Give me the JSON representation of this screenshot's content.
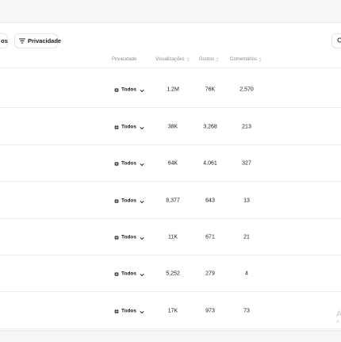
{
  "filters": {
    "left_chip_label": "os",
    "privacy_label": "Privacidade"
  },
  "table": {
    "headers": {
      "privacy": "Privacidade",
      "views": "Visualizações",
      "likes": "Gostos",
      "comments": "Comentários"
    },
    "rows": [
      {
        "privacy": "Todos",
        "views": "1.2M",
        "likes": "76K",
        "comments": "2,570"
      },
      {
        "privacy": "Todos",
        "views": "38K",
        "likes": "3,268",
        "comments": "213"
      },
      {
        "privacy": "Todos",
        "views": "64K",
        "likes": "4,061",
        "comments": "327"
      },
      {
        "privacy": "Todos",
        "views": "8,377",
        "likes": "643",
        "comments": "13"
      },
      {
        "privacy": "Todos",
        "views": "11K",
        "likes": "671",
        "comments": "21"
      },
      {
        "privacy": "Todos",
        "views": "5,252",
        "likes": "279",
        "comments": "4"
      },
      {
        "privacy": "Todos",
        "views": "17K",
        "likes": "973",
        "comments": "73"
      }
    ]
  },
  "watermark": {
    "line1": "A",
    "line2": "A"
  }
}
